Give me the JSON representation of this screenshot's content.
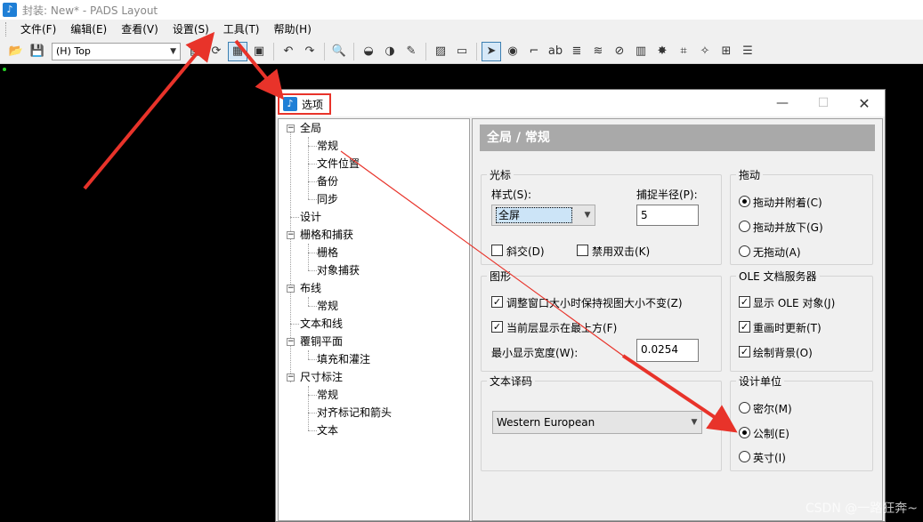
{
  "app": {
    "title": "封装: New* - PADS Layout",
    "icon": "pads-app-icon"
  },
  "menubar": {
    "items": [
      "文件(F)",
      "编辑(E)",
      "查看(V)",
      "设置(S)",
      "工具(T)",
      "帮助(H)"
    ]
  },
  "toolbar": {
    "layer_value": "(H) Top"
  },
  "dialog": {
    "title": "选项",
    "close": "✕",
    "minimize": "—",
    "maximize": "☐",
    "tree": {
      "global": "全局",
      "general": "常规",
      "file_location": "文件位置",
      "backup": "备份",
      "sync": "同步",
      "design": "设计",
      "grid_snap": "栅格和捕获",
      "grid": "栅格",
      "object_snap": "对象捕获",
      "routing": "布线",
      "routing_general": "常规",
      "text_lines": "文本和线",
      "copper_pour": "覆铜平面",
      "fill_flood": "填充和灌注",
      "dimensioning": "尺寸标注",
      "dim_general": "常规",
      "align_arrows": "对齐标记和箭头",
      "dim_text": "文本"
    },
    "panel_title": "全局 / 常规",
    "cursor": {
      "group": "光标",
      "style_label": "样式(S):",
      "style_value": "全屏",
      "snap_radius_label": "捕捉半径(P):",
      "snap_radius_value": "5",
      "diagonal": "斜交(D)",
      "disable_dblclick": "禁用双击(K)",
      "diagonal_checked": false,
      "disable_dblclick_checked": false
    },
    "drag": {
      "group": "拖动",
      "options": [
        "拖动并附着(C)",
        "拖动并放下(G)",
        "无拖动(A)"
      ],
      "selected_index": 0
    },
    "graphics": {
      "group": "图形",
      "keep_view": "调整窗口大小时保持视图大小不变(Z)",
      "keep_view_checked": true,
      "active_top": "当前层显示在最上方(F)",
      "active_top_checked": true,
      "min_width_label": "最小显示宽度(W):",
      "min_width_value": "0.0254"
    },
    "ole": {
      "group": "OLE 文档服务器",
      "show_ole": "显示 OLE 对象(J)",
      "redraw_update": "重画时更新(T)",
      "draw_bg": "绘制背景(O)",
      "show_ole_checked": true,
      "redraw_update_checked": true,
      "draw_bg_checked": true
    },
    "text_encoding": {
      "group": "文本译码",
      "value": "Western European"
    },
    "design_units": {
      "group": "设计单位",
      "options": [
        "密尔(M)",
        "公制(E)",
        "英寸(I)"
      ],
      "selected_index": 1
    }
  },
  "watermark": "CSDN @一路狂奔~",
  "colors": {
    "annotation_red": "#e8332a",
    "panel_header": "#a9a9a9",
    "accent": "#1f7fd6"
  }
}
